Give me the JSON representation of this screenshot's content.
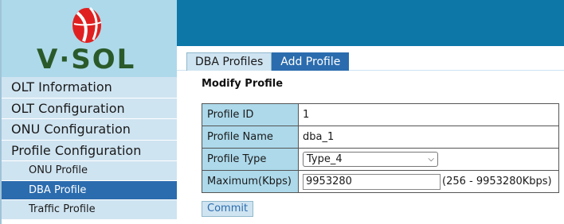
{
  "brand": {
    "logo_text": "V·SOL",
    "colors": {
      "logo_red": "#e02020",
      "logo_green": "#2a5a2a",
      "header": "#0d77a8",
      "active": "#2b6cae",
      "nav_bg": "#cfe4f1",
      "label_bg": "#add9ea"
    }
  },
  "sidebar": {
    "items": [
      {
        "label": "OLT Information"
      },
      {
        "label": "OLT Configuration"
      },
      {
        "label": "ONU Configuration"
      },
      {
        "label": "Profile Configuration"
      }
    ],
    "subitems": [
      {
        "label": "ONU Profile"
      },
      {
        "label": "DBA Profile",
        "active": true
      },
      {
        "label": "Traffic Profile"
      }
    ]
  },
  "tabs": [
    {
      "label": "DBA Profiles",
      "active": false
    },
    {
      "label": "Add Profile",
      "active": true
    }
  ],
  "form": {
    "title": "Modify Profile",
    "rows": [
      {
        "label": "Profile ID",
        "value": "1"
      },
      {
        "label": "Profile Name",
        "value": "dba_1"
      },
      {
        "label": "Profile Type",
        "value": "Type_4"
      },
      {
        "label": "Maximum(Kbps)",
        "value": "9953280",
        "hint": "(256 - 9953280Kbps)"
      }
    ],
    "commit_label": "Commit"
  }
}
